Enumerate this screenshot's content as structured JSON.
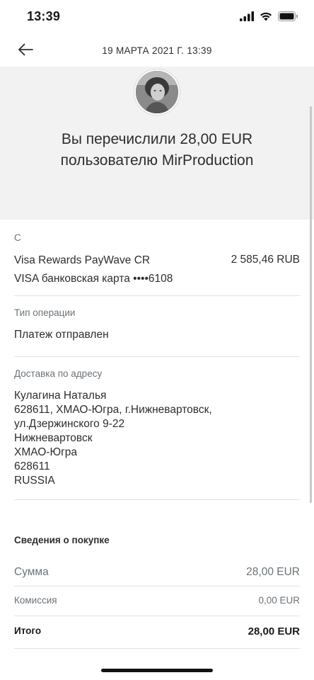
{
  "status_bar": {
    "time": "13:39",
    "icons": [
      "signal-icon",
      "wifi-icon",
      "battery-icon"
    ]
  },
  "nav": {
    "back_icon": "arrow-left-icon",
    "title": "19 МАРТА 2021 Г.  13:39"
  },
  "header": {
    "avatar_icon": "user-photo-avatar",
    "line1": "Вы перечислили 28,00 EUR",
    "line2": "пользователю MirProduction"
  },
  "source": {
    "label": "С",
    "name": "Visa Rewards PayWave CR",
    "amount": "2 585,46 RUB",
    "card": "VISA банковская карта ••••6108"
  },
  "operation": {
    "label": "Тип операции",
    "value": "Платеж отправлен"
  },
  "delivery": {
    "label": "Доставка по адресу",
    "lines": [
      "Кулагина Наталья",
      "628611, ХМАО-Югра, г.Нижневартовск,",
      "ул.Дзержинского 9-22",
      "Нижневартовск",
      "ХМАО-Югра",
      "628611",
      "RUSSIA"
    ]
  },
  "purchase": {
    "title": "Сведения о покупке",
    "sum_label": "Сумма",
    "sum_value": "28,00 EUR",
    "fee_label": "Комиссия",
    "fee_value": "0,00 EUR",
    "total_label": "Итого",
    "total_value": "28,00 EUR"
  },
  "colors": {
    "header_bg": "#f2f2f2",
    "text_primary": "#2c2e2f",
    "text_secondary": "#6c7378",
    "divider": "#e3e3e3"
  }
}
